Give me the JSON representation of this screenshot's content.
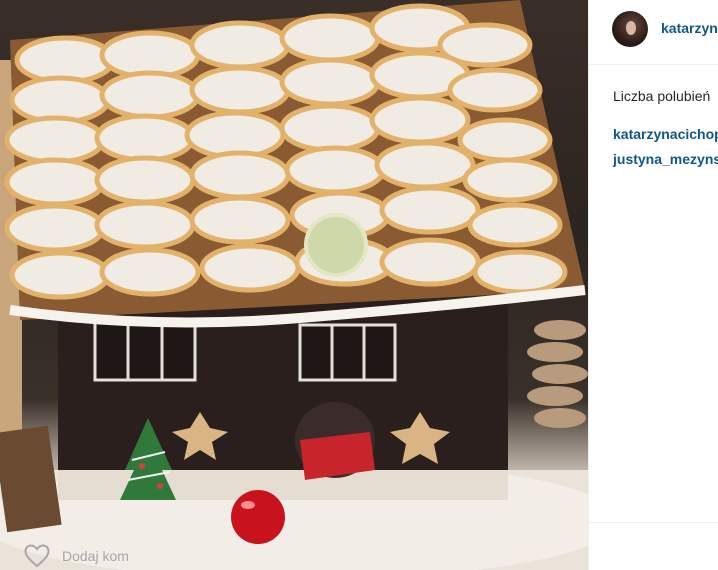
{
  "post": {
    "username": "katarzyn",
    "likes_label": "Liczba polubień",
    "comments": [
      {
        "username": "katarzynacichop"
      },
      {
        "username": "justyna_mezyns"
      }
    ],
    "add_comment_placeholder": "Dodaj kom"
  },
  "icons": {
    "like": "heart-icon"
  },
  "colors": {
    "link": "#125688",
    "text": "#262626",
    "placeholder": "#a5a7aa"
  }
}
